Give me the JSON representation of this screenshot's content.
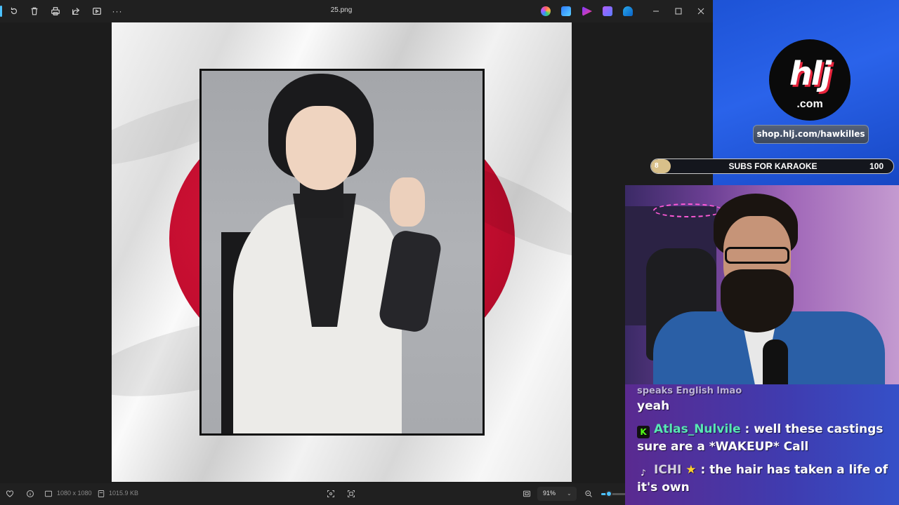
{
  "viewer": {
    "file_name": "25.png",
    "toolbar": {
      "rotate_icon": "rotate-icon",
      "delete_icon": "trash-icon",
      "print_icon": "printer-icon",
      "share_icon": "share-icon",
      "slideshow_icon": "slideshow-icon",
      "more_label": "···"
    },
    "app_icons": [
      "copilot-icon",
      "edit-image-icon",
      "clipchamp-icon",
      "editor-icon",
      "onedrive-icon"
    ],
    "window_controls": [
      "minimize",
      "maximize",
      "close"
    ],
    "status": {
      "dimensions": "1080 x 1080",
      "file_size": "1015.9 KB",
      "zoom": "91%",
      "zoom_fraction": 0.12
    }
  },
  "overlay": {
    "logo_main": "hlj",
    "logo_sub": ".com",
    "shop_url": "shop.hlj.com/hawkilles",
    "goal": {
      "current": "8",
      "label": "SUBS FOR KARAOKE",
      "target": "100",
      "progress_fraction": 0.08
    }
  },
  "chat": {
    "faded_line": "speaks English lmao",
    "messages": [
      {
        "text": "yeah"
      },
      {
        "platform": "kick",
        "platform_glyph": "K",
        "user": "Atlas_Nulvile",
        "sep": " : ",
        "text": "well these castings sure are a *WAKEUP* Call"
      },
      {
        "platform": "tiktok",
        "platform_glyph": "♪",
        "user": "ICHI",
        "badge": "★",
        "sep": " : ",
        "text": "the hair has taken a life of it's own"
      }
    ]
  },
  "colors": {
    "accent": "#4cc2ff",
    "overlay_blue": "#1d53d6",
    "flag_red": "#c10c2e"
  }
}
